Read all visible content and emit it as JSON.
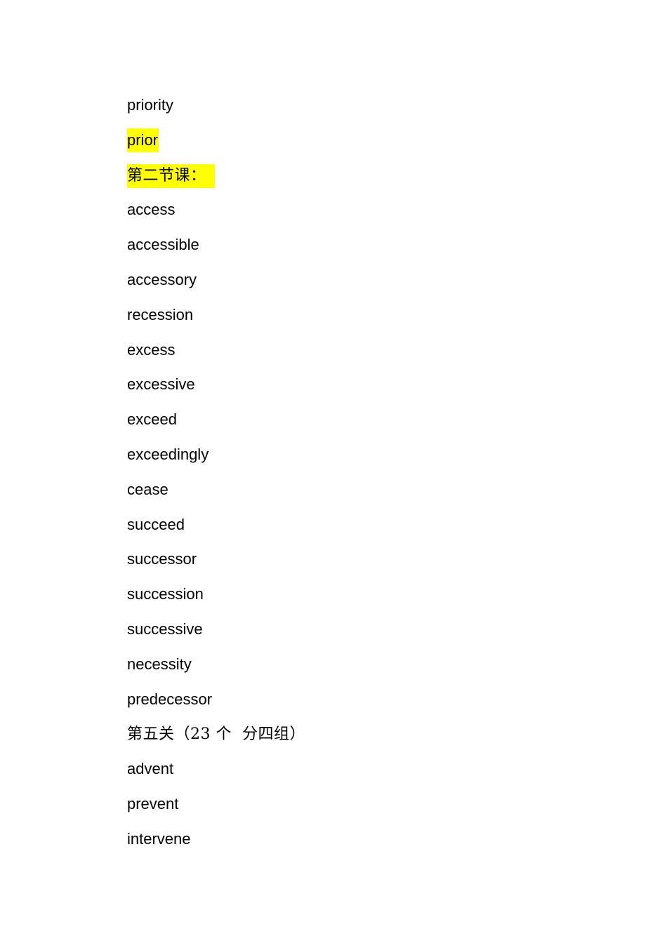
{
  "document": {
    "highlight_color": "#ffff00",
    "lines": [
      {
        "text": "priority",
        "highlight": false,
        "cjk": false
      },
      {
        "text": "prior",
        "highlight": true,
        "cjk": false
      },
      {
        "text": "第二节课：",
        "highlight": true,
        "cjk": true
      },
      {
        "text": "access",
        "highlight": false,
        "cjk": false
      },
      {
        "text": "accessible",
        "highlight": false,
        "cjk": false
      },
      {
        "text": "accessory",
        "highlight": false,
        "cjk": false
      },
      {
        "text": "recession",
        "highlight": false,
        "cjk": false
      },
      {
        "text": "excess",
        "highlight": false,
        "cjk": false
      },
      {
        "text": "excessive",
        "highlight": false,
        "cjk": false
      },
      {
        "text": "exceed",
        "highlight": false,
        "cjk": false
      },
      {
        "text": "exceedingly",
        "highlight": false,
        "cjk": false
      },
      {
        "text": "cease",
        "highlight": false,
        "cjk": false
      },
      {
        "text": "succeed",
        "highlight": false,
        "cjk": false
      },
      {
        "text": "successor",
        "highlight": false,
        "cjk": false
      },
      {
        "text": "succession",
        "highlight": false,
        "cjk": false
      },
      {
        "text": "successive",
        "highlight": false,
        "cjk": false
      },
      {
        "text": "necessity",
        "highlight": false,
        "cjk": false
      },
      {
        "text": "predecessor",
        "highlight": false,
        "cjk": false
      },
      {
        "text": "第五关（23 个  分四组）",
        "highlight": false,
        "cjk": true
      },
      {
        "text": "advent",
        "highlight": false,
        "cjk": false
      },
      {
        "text": "prevent",
        "highlight": false,
        "cjk": false
      },
      {
        "text": "intervene",
        "highlight": false,
        "cjk": false
      }
    ]
  }
}
